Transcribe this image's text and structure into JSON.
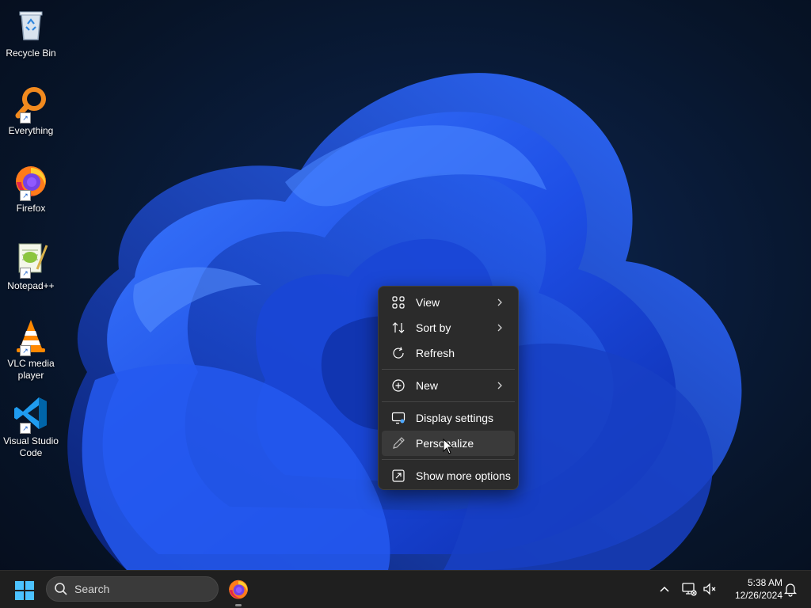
{
  "desktop": {
    "icons": [
      {
        "label": "Recycle Bin",
        "icon": "recycle-bin-icon"
      },
      {
        "label": "Everything",
        "icon": "everything-search-icon"
      },
      {
        "label": "Firefox",
        "icon": "firefox-icon"
      },
      {
        "label": "Notepad++",
        "icon": "notepad-plus-plus-icon"
      },
      {
        "label": "VLC media player",
        "icon": "vlc-icon"
      },
      {
        "label": "Visual Studio Code",
        "icon": "vscode-icon"
      }
    ]
  },
  "context_menu": {
    "items": [
      {
        "label": "View",
        "icon": "grid-icon",
        "has_submenu": true
      },
      {
        "label": "Sort by",
        "icon": "sort-icon",
        "has_submenu": true
      },
      {
        "label": "Refresh",
        "icon": "refresh-icon",
        "has_submenu": false
      },
      {
        "label": "New",
        "icon": "plus-circle-icon",
        "has_submenu": true
      },
      {
        "label": "Display settings",
        "icon": "display-icon",
        "has_submenu": false
      },
      {
        "label": "Personalize",
        "icon": "pen-icon",
        "has_submenu": false,
        "hovered": true
      },
      {
        "label": "Show more options",
        "icon": "expand-icon",
        "has_submenu": false
      }
    ]
  },
  "taskbar": {
    "search_placeholder": "Search",
    "pinned": [
      {
        "name": "Firefox",
        "icon": "firefox-icon",
        "running": true
      }
    ],
    "tray": {
      "time": "5:38 AM",
      "date": "12/26/2024"
    }
  },
  "colors": {
    "menu_bg": "#2b2b2b",
    "menu_hover": "#3a3a3a",
    "taskbar_bg": "#1f1f1f",
    "accent": "#0078d4",
    "bloom_blue": "#1b4fe0"
  }
}
